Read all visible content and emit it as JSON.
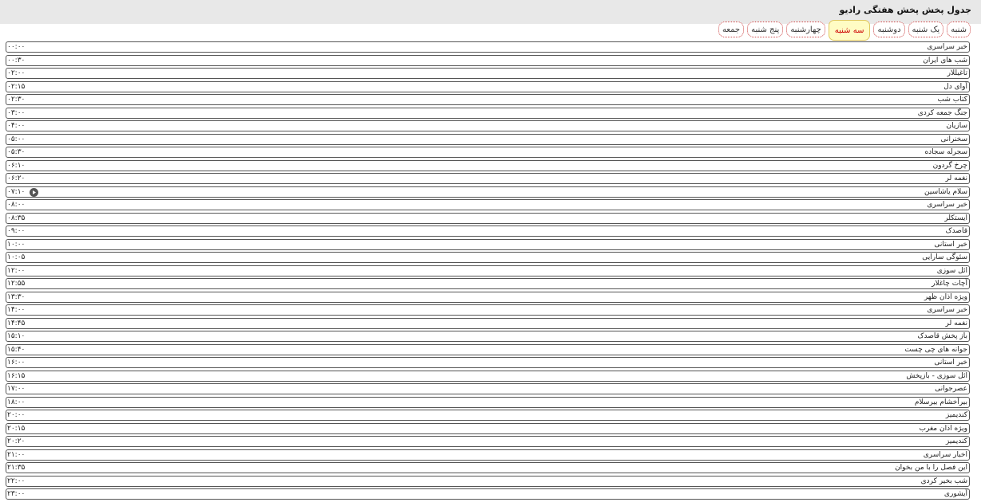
{
  "header": {
    "title": "جدول پخش پخش هفتگی رادیو"
  },
  "tabs": [
    {
      "label": "شنبه",
      "active": false
    },
    {
      "label": "یک شنبه",
      "active": false
    },
    {
      "label": "دوشنبه",
      "active": false
    },
    {
      "label": "سه شنبه",
      "active": true
    },
    {
      "label": "چهارشنبه",
      "active": false
    },
    {
      "label": "پنج شنبه",
      "active": false
    },
    {
      "label": "جمعه",
      "active": false
    }
  ],
  "colors": {
    "active_tab_bg": "#fffcc4",
    "active_tab_text": "#cc0000",
    "tab_border": "#cc4444",
    "header_bg": "#e8e8e8"
  },
  "schedule": [
    {
      "title": "خبر سراسری",
      "time": "۰۰:۰۰"
    },
    {
      "title": "شب های ایران",
      "time": "۰۰:۳۰"
    },
    {
      "title": "تاغیللار",
      "time": "۰۲:۰۰"
    },
    {
      "title": "آوای دل",
      "time": "۰۲:۱۵"
    },
    {
      "title": "کتاب شب",
      "time": "۰۲:۳۰"
    },
    {
      "title": "جنگ جمعه کردی",
      "time": "۰۳:۰۰"
    },
    {
      "title": "سازیان",
      "time": "۰۴:۰۰"
    },
    {
      "title": "سخنرانی",
      "time": "۰۵:۰۰"
    },
    {
      "title": "سجرله سجاده",
      "time": "۰۵:۳۰"
    },
    {
      "title": "چرخ گردون",
      "time": "۰۶:۱۰"
    },
    {
      "title": "نغمه لر",
      "time": "۰۶:۲۰"
    },
    {
      "title": "سلام یاشاسین",
      "time": "۰۷:۱۰",
      "playing": true
    },
    {
      "title": "خبر سراسری",
      "time": "۰۸:۰۰"
    },
    {
      "title": "ایستکلر",
      "time": "۰۸:۳۵"
    },
    {
      "title": "قاصدک",
      "time": "۰۹:۰۰"
    },
    {
      "title": "خبر استانی",
      "time": "۱۰:۰۰"
    },
    {
      "title": "سئوگی سارایی",
      "time": "۱۰:۰۵"
    },
    {
      "title": "ائل سوزی",
      "time": "۱۲:۰۰"
    },
    {
      "title": "آچات چاغلار",
      "time": "۱۲:۵۵"
    },
    {
      "title": "ویژه اذان ظهر",
      "time": "۱۳:۳۰"
    },
    {
      "title": "خبر سراسری",
      "time": "۱۴:۰۰"
    },
    {
      "title": "نغمه لر",
      "time": "۱۴:۴۵"
    },
    {
      "title": "باز پخش قاصدک",
      "time": "۱۵:۱۰"
    },
    {
      "title": "جوانه های چی چست",
      "time": "۱۵:۴۰"
    },
    {
      "title": "خبر استانی",
      "time": "۱۶:۰۰"
    },
    {
      "title": "ائل سوزی - بازپخش",
      "time": "۱۶:۱۵"
    },
    {
      "title": "عصرجوانی",
      "time": "۱۷:۰۰"
    },
    {
      "title": "بیرآخشام بیرسلام",
      "time": "۱۸:۰۰"
    },
    {
      "title": "کندیمیز",
      "time": "۲۰:۰۰"
    },
    {
      "title": "ویژه اذان مغرب",
      "time": "۲۰:۱۵"
    },
    {
      "title": "کندیمیز",
      "time": "۲۰:۲۰"
    },
    {
      "title": "اخبار سراسری",
      "time": "۲۱:۰۰"
    },
    {
      "title": "این فصل را با من بخوان",
      "time": "۲۱:۳۵"
    },
    {
      "title": "شب بخیر کردی",
      "time": "۲۲:۰۰"
    },
    {
      "title": "آیشوری",
      "time": "۲۳:۰۰"
    }
  ]
}
